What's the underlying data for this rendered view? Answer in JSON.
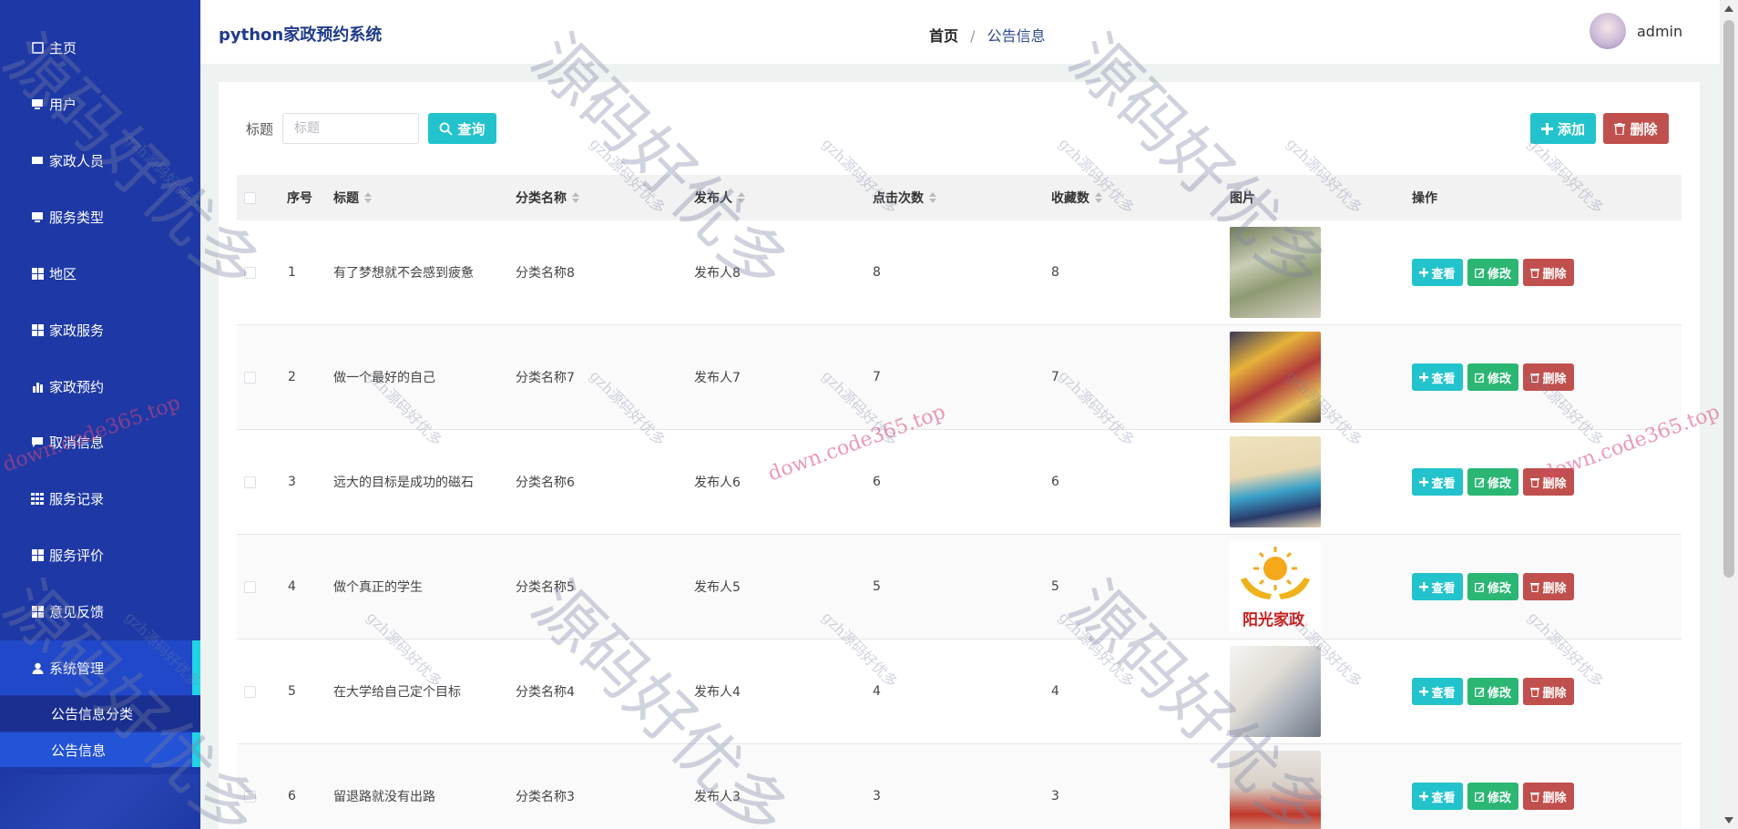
{
  "app": {
    "title": "python家政预约系统"
  },
  "breadcrumb": {
    "home": "首页",
    "separator": "/",
    "current": "公告信息"
  },
  "user": {
    "name": "admin"
  },
  "sidebar": {
    "items": [
      {
        "label": "主页",
        "icon": "home-icon"
      },
      {
        "label": "用户",
        "icon": "monitor-icon"
      },
      {
        "label": "家政人员",
        "icon": "ticket-icon"
      },
      {
        "label": "服务类型",
        "icon": "monitor-icon"
      },
      {
        "label": "地区",
        "icon": "grid-icon"
      },
      {
        "label": "家政服务",
        "icon": "grid-icon"
      },
      {
        "label": "家政预约",
        "icon": "bar-chart-icon"
      },
      {
        "label": "取消信息",
        "icon": "comment-icon"
      },
      {
        "label": "服务记录",
        "icon": "table-icon"
      },
      {
        "label": "服务评价",
        "icon": "grid-icon"
      },
      {
        "label": "意见反馈",
        "icon": "grid-icon"
      },
      {
        "label": "系统管理",
        "icon": "user-icon"
      }
    ],
    "subitems": [
      {
        "label": "公告信息分类"
      },
      {
        "label": "公告信息"
      }
    ]
  },
  "search": {
    "label": "标题",
    "placeholder": "标题",
    "query_label": "查询"
  },
  "actions": {
    "add_label": "添加",
    "delete_label": "删除"
  },
  "table": {
    "headers": {
      "index": "序号",
      "title": "标题",
      "category": "分类名称",
      "publisher": "发布人",
      "clicks": "点击次数",
      "favorites": "收藏数",
      "image": "图片",
      "ops": "操作"
    },
    "row_buttons": {
      "view": "查看",
      "edit": "修改",
      "delete": "删除"
    },
    "rows": [
      {
        "index": "1",
        "title": "有了梦想就不会感到疲惫",
        "category": "分类名称8",
        "publisher": "发布人8",
        "clicks": "8",
        "favorites": "8",
        "image": "cleaning-staff-group-photo"
      },
      {
        "index": "2",
        "title": "做一个最好的自己",
        "category": "分类名称7",
        "publisher": "发布人7",
        "clicks": "7",
        "favorites": "7",
        "image": "staff-uniform-photo"
      },
      {
        "index": "3",
        "title": "远大的目标是成功的磁石",
        "category": "分类名称6",
        "publisher": "发布人6",
        "clicks": "6",
        "favorites": "6",
        "image": "cleaning-worker-photo"
      },
      {
        "index": "4",
        "title": "做个真正的学生",
        "category": "分类名称5",
        "publisher": "发布人5",
        "clicks": "5",
        "favorites": "5",
        "image": "sunshine-housekeeping-logo"
      },
      {
        "index": "5",
        "title": "在大学给自己定个目标",
        "category": "分类名称4",
        "publisher": "发布人4",
        "clicks": "4",
        "favorites": "4",
        "image": "elder-care-photo"
      },
      {
        "index": "6",
        "title": "留退路就没有出路",
        "category": "分类名称3",
        "publisher": "发布人3",
        "clicks": "3",
        "favorites": "3",
        "image": "interior-cleaning-photo"
      }
    ]
  },
  "logo": {
    "text": "阳光家政"
  },
  "watermarks": {
    "big": "源码好优多",
    "url": "down.code365.top",
    "small": "gzh源码好优多"
  }
}
